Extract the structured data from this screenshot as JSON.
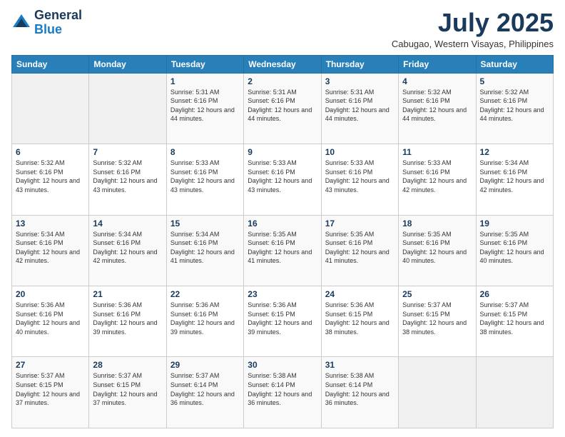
{
  "header": {
    "logo_general": "General",
    "logo_blue": "Blue",
    "month_title": "July 2025",
    "location": "Cabugao, Western Visayas, Philippines"
  },
  "days_of_week": [
    "Sunday",
    "Monday",
    "Tuesday",
    "Wednesday",
    "Thursday",
    "Friday",
    "Saturday"
  ],
  "weeks": [
    [
      {
        "day": "",
        "empty": true
      },
      {
        "day": "",
        "empty": true
      },
      {
        "day": "1",
        "sunrise": "5:31 AM",
        "sunset": "6:16 PM",
        "daylight": "12 hours and 44 minutes."
      },
      {
        "day": "2",
        "sunrise": "5:31 AM",
        "sunset": "6:16 PM",
        "daylight": "12 hours and 44 minutes."
      },
      {
        "day": "3",
        "sunrise": "5:31 AM",
        "sunset": "6:16 PM",
        "daylight": "12 hours and 44 minutes."
      },
      {
        "day": "4",
        "sunrise": "5:32 AM",
        "sunset": "6:16 PM",
        "daylight": "12 hours and 44 minutes."
      },
      {
        "day": "5",
        "sunrise": "5:32 AM",
        "sunset": "6:16 PM",
        "daylight": "12 hours and 44 minutes."
      }
    ],
    [
      {
        "day": "6",
        "sunrise": "5:32 AM",
        "sunset": "6:16 PM",
        "daylight": "12 hours and 43 minutes."
      },
      {
        "day": "7",
        "sunrise": "5:32 AM",
        "sunset": "6:16 PM",
        "daylight": "12 hours and 43 minutes."
      },
      {
        "day": "8",
        "sunrise": "5:33 AM",
        "sunset": "6:16 PM",
        "daylight": "12 hours and 43 minutes."
      },
      {
        "day": "9",
        "sunrise": "5:33 AM",
        "sunset": "6:16 PM",
        "daylight": "12 hours and 43 minutes."
      },
      {
        "day": "10",
        "sunrise": "5:33 AM",
        "sunset": "6:16 PM",
        "daylight": "12 hours and 43 minutes."
      },
      {
        "day": "11",
        "sunrise": "5:33 AM",
        "sunset": "6:16 PM",
        "daylight": "12 hours and 42 minutes."
      },
      {
        "day": "12",
        "sunrise": "5:34 AM",
        "sunset": "6:16 PM",
        "daylight": "12 hours and 42 minutes."
      }
    ],
    [
      {
        "day": "13",
        "sunrise": "5:34 AM",
        "sunset": "6:16 PM",
        "daylight": "12 hours and 42 minutes."
      },
      {
        "day": "14",
        "sunrise": "5:34 AM",
        "sunset": "6:16 PM",
        "daylight": "12 hours and 42 minutes."
      },
      {
        "day": "15",
        "sunrise": "5:34 AM",
        "sunset": "6:16 PM",
        "daylight": "12 hours and 41 minutes."
      },
      {
        "day": "16",
        "sunrise": "5:35 AM",
        "sunset": "6:16 PM",
        "daylight": "12 hours and 41 minutes."
      },
      {
        "day": "17",
        "sunrise": "5:35 AM",
        "sunset": "6:16 PM",
        "daylight": "12 hours and 41 minutes."
      },
      {
        "day": "18",
        "sunrise": "5:35 AM",
        "sunset": "6:16 PM",
        "daylight": "12 hours and 40 minutes."
      },
      {
        "day": "19",
        "sunrise": "5:35 AM",
        "sunset": "6:16 PM",
        "daylight": "12 hours and 40 minutes."
      }
    ],
    [
      {
        "day": "20",
        "sunrise": "5:36 AM",
        "sunset": "6:16 PM",
        "daylight": "12 hours and 40 minutes."
      },
      {
        "day": "21",
        "sunrise": "5:36 AM",
        "sunset": "6:16 PM",
        "daylight": "12 hours and 39 minutes."
      },
      {
        "day": "22",
        "sunrise": "5:36 AM",
        "sunset": "6:16 PM",
        "daylight": "12 hours and 39 minutes."
      },
      {
        "day": "23",
        "sunrise": "5:36 AM",
        "sunset": "6:15 PM",
        "daylight": "12 hours and 39 minutes."
      },
      {
        "day": "24",
        "sunrise": "5:36 AM",
        "sunset": "6:15 PM",
        "daylight": "12 hours and 38 minutes."
      },
      {
        "day": "25",
        "sunrise": "5:37 AM",
        "sunset": "6:15 PM",
        "daylight": "12 hours and 38 minutes."
      },
      {
        "day": "26",
        "sunrise": "5:37 AM",
        "sunset": "6:15 PM",
        "daylight": "12 hours and 38 minutes."
      }
    ],
    [
      {
        "day": "27",
        "sunrise": "5:37 AM",
        "sunset": "6:15 PM",
        "daylight": "12 hours and 37 minutes."
      },
      {
        "day": "28",
        "sunrise": "5:37 AM",
        "sunset": "6:15 PM",
        "daylight": "12 hours and 37 minutes."
      },
      {
        "day": "29",
        "sunrise": "5:37 AM",
        "sunset": "6:14 PM",
        "daylight": "12 hours and 36 minutes."
      },
      {
        "day": "30",
        "sunrise": "5:38 AM",
        "sunset": "6:14 PM",
        "daylight": "12 hours and 36 minutes."
      },
      {
        "day": "31",
        "sunrise": "5:38 AM",
        "sunset": "6:14 PM",
        "daylight": "12 hours and 36 minutes."
      },
      {
        "day": "",
        "empty": true
      },
      {
        "day": "",
        "empty": true
      }
    ]
  ]
}
